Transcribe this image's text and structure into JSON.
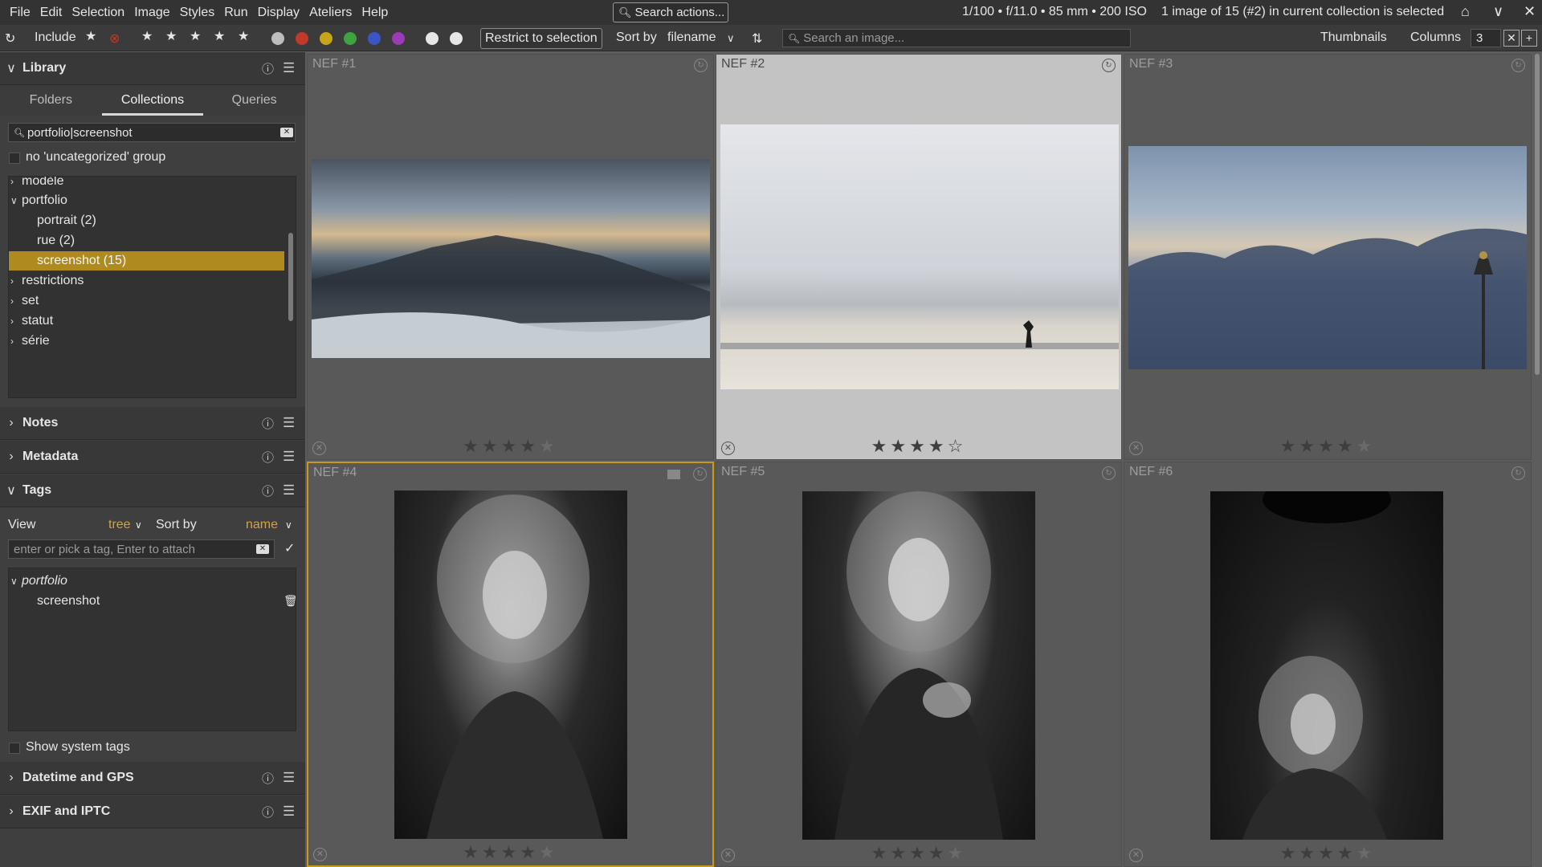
{
  "menubar": {
    "items": [
      "File",
      "Edit",
      "Selection",
      "Image",
      "Styles",
      "Run",
      "Display",
      "Ateliers",
      "Help"
    ],
    "search_actions": "Search actions...",
    "exif_info": "1/100 • f/11.0 • 85 mm • 200 ISO",
    "selection_info": "1 image of 15 (#2) in current collection is selected"
  },
  "toolbar": {
    "include_label": "Include",
    "restrict_label": "Restrict to selection",
    "sort_by_label": "Sort by",
    "sort_value": "filename",
    "search_placeholder": "Search an image...",
    "thumbnails_label": "Thumbnails",
    "columns_label": "Columns",
    "columns_value": "3",
    "color_labels": [
      "#bdbdbd",
      "#c0392b",
      "#c8a418",
      "#3fa33f",
      "#3b56c4",
      "#9b3bb5"
    ]
  },
  "library": {
    "title": "Library",
    "tabs": [
      "Folders",
      "Collections",
      "Queries"
    ],
    "active_tab": "Collections",
    "filter_value": "portfolio|screenshot",
    "no_uncat_label": "no 'uncategorized' group",
    "tree": [
      {
        "label": "modèle",
        "level": 0,
        "expanded": false
      },
      {
        "label": "portfolio",
        "level": 0,
        "expanded": true
      },
      {
        "label": "portrait (2)",
        "level": 1
      },
      {
        "label": "rue (2)",
        "level": 1
      },
      {
        "label": "screenshot (15)",
        "level": 1,
        "selected": true
      },
      {
        "label": "restrictions",
        "level": 0,
        "expanded": false
      },
      {
        "label": "set",
        "level": 0,
        "expanded": false
      },
      {
        "label": "statut",
        "level": 0,
        "expanded": false
      },
      {
        "label": "série",
        "level": 0,
        "expanded": false
      }
    ]
  },
  "sections": {
    "notes": "Notes",
    "metadata": "Metadata",
    "tags": "Tags",
    "datetime": "Datetime and GPS",
    "exif": "EXIF and IPTC"
  },
  "tags": {
    "view_label": "View",
    "view_value": "tree",
    "sort_label": "Sort by",
    "sort_value": "name",
    "input_placeholder": "enter or pick a tag, Enter to attach",
    "tree": [
      {
        "label": "portfolio",
        "level": 0
      },
      {
        "label": "screenshot",
        "level": 1
      }
    ],
    "show_system_label": "Show system tags"
  },
  "thumbnails": [
    {
      "name": "NEF #1",
      "rating": 4,
      "selected": false,
      "current": false
    },
    {
      "name": "NEF #2",
      "rating": 4,
      "selected": true,
      "current": false
    },
    {
      "name": "NEF #3",
      "rating": 4,
      "selected": false,
      "current": false
    },
    {
      "name": "NEF #4",
      "rating": 4,
      "selected": false,
      "current": true
    },
    {
      "name": "NEF #5",
      "rating": 4,
      "selected": false,
      "current": false
    },
    {
      "name": "NEF #6",
      "rating": 4,
      "selected": false,
      "current": false
    }
  ]
}
